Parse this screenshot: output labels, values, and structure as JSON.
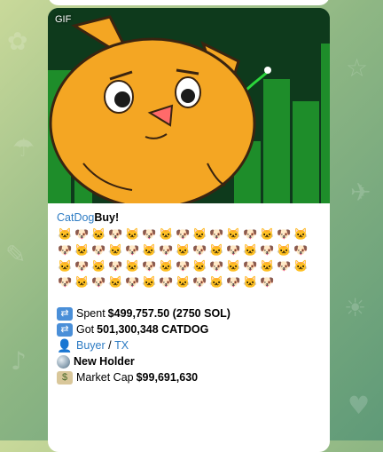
{
  "message": {
    "gif_label": "GIF",
    "token_link": "CatDog",
    "action": " Buy!",
    "emoji_count": 58,
    "emoji_pattern": [
      "🐱",
      "🐶"
    ],
    "spent_label": "Spent ",
    "spent_value": "$499,757.50 (2750 SOL)",
    "got_label": "Got ",
    "got_value": "501,300,348 CATDOG",
    "buyer_link": "Buyer",
    "separator": " / ",
    "tx_link": "TX",
    "new_holder": "New Holder",
    "mcap_label": "Market Cap ",
    "mcap_value": "$99,691,630"
  },
  "colors": {
    "link": "#2e7cc4",
    "chart_bars": "#1f8f2a",
    "cat_orange": "#f4a623",
    "background": "#8fb784"
  },
  "icons": {
    "shuffle": "shuffle-icon",
    "person": "person-icon",
    "globe": "globe-icon",
    "money": "money-icon"
  }
}
